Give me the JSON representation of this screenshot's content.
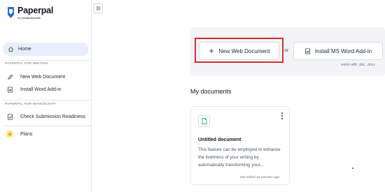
{
  "brand": {
    "name": "Paperpal",
    "sub_prefix": "By",
    "sub_name": "researcher.life",
    "logo_icon": "paperpal-logo-icon"
  },
  "sidebar": {
    "collapse_icon": "menu-icon",
    "home": {
      "label": "Home",
      "icon": "home-icon"
    },
    "section_writing": "PAPERPAL FOR WRITING",
    "writing_items": [
      {
        "label": "New Web Document",
        "icon": "edit-pen-icon"
      },
      {
        "label": "Install Word Add-in",
        "icon": "word-document-icon"
      }
    ],
    "section_manuscript": "PAPERPAL FOR MANUSCRIPT",
    "manuscript_items": [
      {
        "label": "Check Submission Readiness",
        "icon": "checklist-icon"
      }
    ],
    "plans": {
      "label": "Plans",
      "icon": "star-icon"
    }
  },
  "hero": {
    "new_doc_label": "New Web Document",
    "new_doc_icon": "plus-icon",
    "or_label": "or",
    "install_label": "Install MS Word Add-in",
    "install_icon": "word-addin-icon",
    "works_with": "works with .doc, .docx"
  },
  "documents": {
    "heading": "My documents",
    "items": [
      {
        "title": "Untitled document",
        "snippet": "This feature can be employed to enhance the liveliness of your writing by automatically transforming your...",
        "edited": "last edited 23 minutes ago",
        "icon": "document-icon",
        "menu_icon": "more-vertical-icon"
      }
    ]
  },
  "colors": {
    "accent": "#2563eb",
    "highlight_border": "#d32f2f",
    "home_active_bg": "#e8eef9",
    "hero_bg": "#f2f4f7",
    "star": "#f59e0b",
    "doc_icon": "#10b981"
  }
}
